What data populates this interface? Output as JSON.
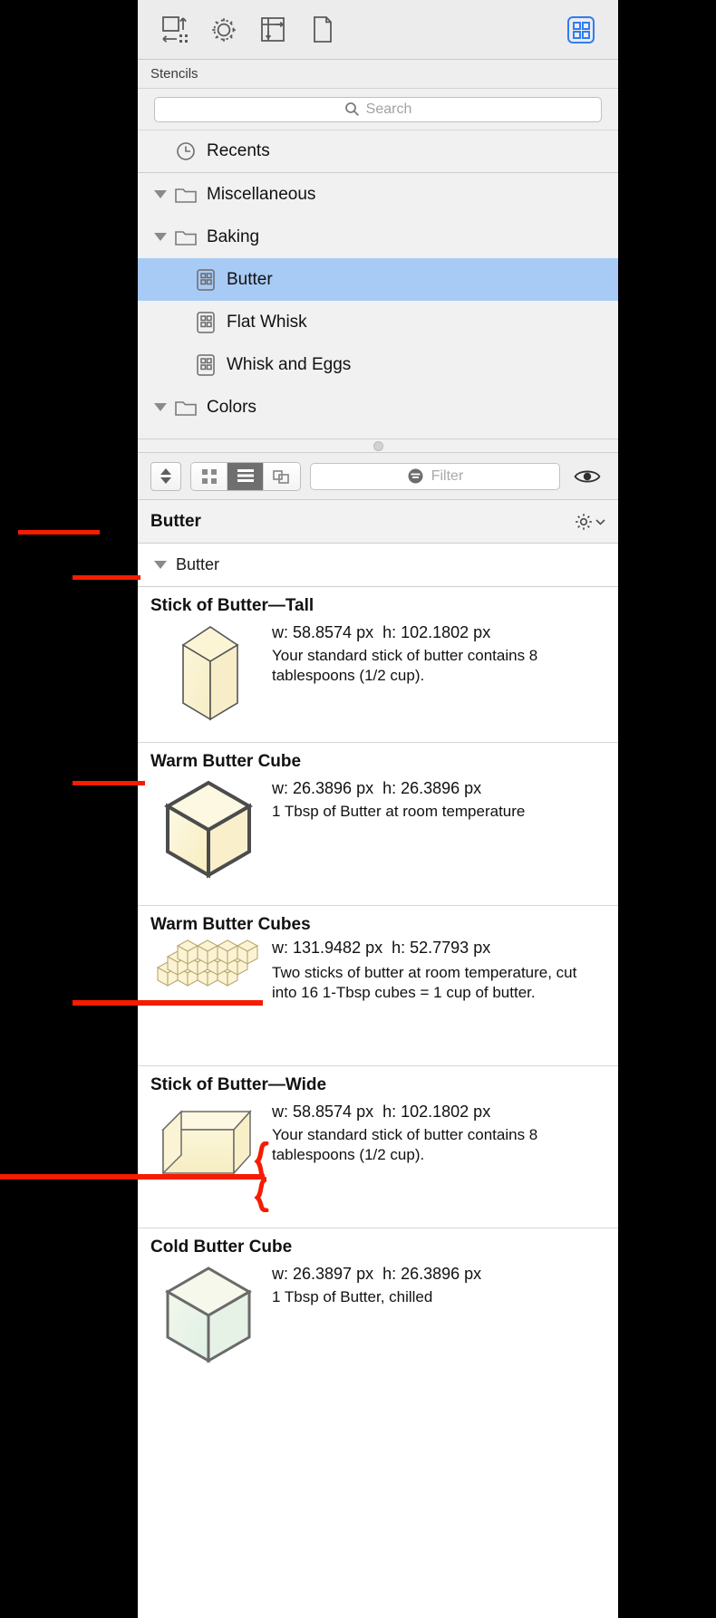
{
  "toolbar": {
    "buttons": [
      {
        "name": "canvas-size-icon",
        "label": "Canvas Size"
      },
      {
        "name": "gear-icon",
        "label": "Settings"
      },
      {
        "name": "alignment-icon",
        "label": "Alignment"
      },
      {
        "name": "document-icon",
        "label": "Document"
      }
    ],
    "right_button": {
      "name": "stencils-icon",
      "label": "Stencils",
      "active": true
    },
    "accent_color": "#2f7cf6"
  },
  "stencils_bar": {
    "title": "Stencils"
  },
  "search": {
    "placeholder": "Search",
    "value": ""
  },
  "tree": {
    "items": [
      {
        "label": "Recents",
        "icon": "clock-icon",
        "indent": 1,
        "disclosure": false,
        "selected": false
      },
      {
        "label": "Miscellaneous",
        "icon": "folder-icon",
        "indent": 1,
        "disclosure": true,
        "selected": false
      },
      {
        "label": "Baking",
        "icon": "folder-icon",
        "indent": 1,
        "disclosure": true,
        "selected": false
      },
      {
        "label": "Butter",
        "icon": "stencil-icon",
        "indent": 2,
        "disclosure": false,
        "selected": true
      },
      {
        "label": "Flat Whisk",
        "icon": "stencil-icon",
        "indent": 2,
        "disclosure": false,
        "selected": false
      },
      {
        "label": "Whisk and Eggs",
        "icon": "stencil-icon",
        "indent": 2,
        "disclosure": false,
        "selected": false
      },
      {
        "label": "Colors",
        "icon": "folder-icon",
        "indent": 1,
        "disclosure": true,
        "selected": false
      }
    ],
    "selection_color": "#a8cbf5"
  },
  "filter_bar": {
    "stepper": "size-stepper",
    "view_modes": [
      {
        "name": "grid-view-icon",
        "selected": false
      },
      {
        "name": "list-view-icon",
        "selected": true
      },
      {
        "name": "overlap-view-icon",
        "selected": false
      }
    ],
    "filter": {
      "placeholder": "Filter",
      "value": ""
    },
    "eye": "eye-icon"
  },
  "library": {
    "title": "Butter",
    "gear_label": "",
    "group": {
      "label": "Butter",
      "expanded": true
    },
    "items": [
      {
        "title": "Stick of Butter—Tall",
        "width": "w: 58.8574 px",
        "height": "h: 102.1802 px",
        "description": "Your standard stick of butter contains 8 tablespoons (1/2 cup).",
        "shape": "tall-box"
      },
      {
        "title": "Warm Butter Cube",
        "width": "w: 26.3896 px",
        "height": "h: 26.3896 px",
        "description": "1 Tbsp of Butter at room temperature",
        "shape": "cube-warm"
      },
      {
        "title": "Warm Butter Cubes",
        "width": "w: 131.9482 px",
        "height": "h: 52.7793 px",
        "description": "Two sticks of butter at room temperature, cut into 16 1-Tbsp cubes = 1 cup of butter.",
        "shape": "cube-stack"
      },
      {
        "title": "Stick of Butter—Wide",
        "width": "w: 58.8574 px",
        "height": "h: 102.1802 px",
        "description": "Your standard stick of butter contains 8 tablespoons (1/2 cup).",
        "shape": "wide-box"
      },
      {
        "title": "Cold Butter Cube",
        "width": "w: 26.3897 px",
        "height": "h: 26.3896 px",
        "description": "1 Tbsp of Butter, chilled",
        "shape": "cube-cold"
      }
    ]
  },
  "annotations": {
    "color": "#f51c00",
    "count": 5
  }
}
